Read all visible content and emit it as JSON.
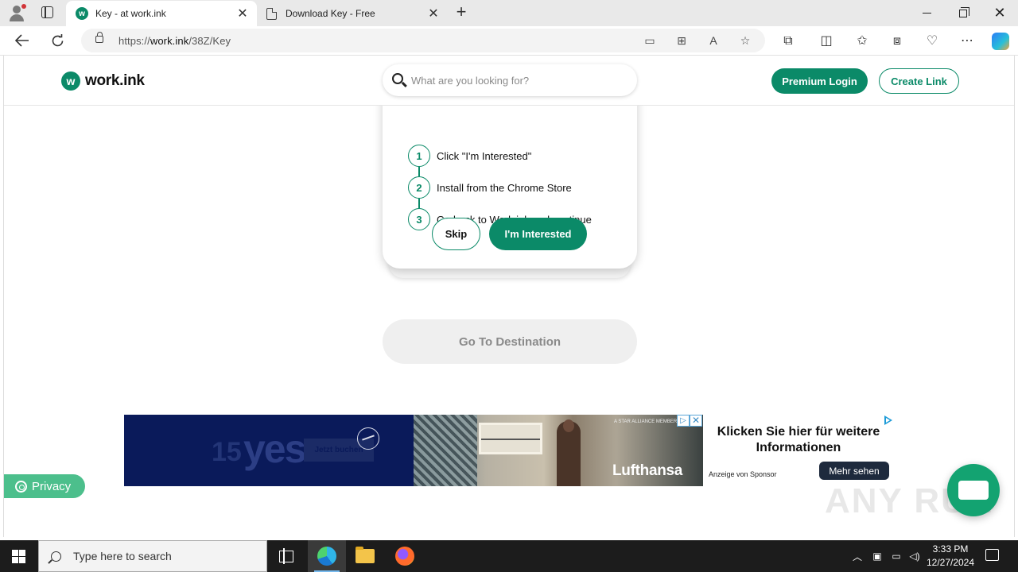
{
  "browser": {
    "tabs": [
      {
        "title": "Key - at work.ink",
        "favicon": "work-ink-icon",
        "active": true
      },
      {
        "title": "Download Key - Free",
        "favicon": "page-icon",
        "active": false
      }
    ],
    "tab_close": "✕",
    "new_tab": "+",
    "url_prefix": "https://",
    "url_host": "work.ink",
    "url_path": "/38Z/Key"
  },
  "site": {
    "logo_mark": "w",
    "logo_text": "work.ink",
    "search_placeholder": "What are you looking for?",
    "premium_login": "Premium Login",
    "create_link": "Create Link"
  },
  "modal": {
    "steps": [
      {
        "num": "1",
        "text": "Click \"I'm Interested\""
      },
      {
        "num": "2",
        "text": "Install from the Chrome Store"
      },
      {
        "num": "3",
        "text": "Go back to Work.ink and continue"
      }
    ],
    "skip": "Skip",
    "interested": "I'm Interested"
  },
  "destination_button": "Go To Destination",
  "ad": {
    "big_text": "yes",
    "cta_left": "Jetzt buchen",
    "brand": "Lufthansa",
    "alliance": "A STAR ALLIANCE MEMBER",
    "headline": "Klicken Sie hier für weitere Informationen",
    "sponsor": "Anzeige von Sponsor",
    "more": "Mehr sehen",
    "close": "✕",
    "adchoice": "▷"
  },
  "privacy_label": "Privacy",
  "watermark": "ANY RUN",
  "taskbar": {
    "search_placeholder": "Type here to search",
    "time": "3:33 PM",
    "date": "12/27/2024"
  },
  "colors": {
    "brand_green": "#0b8a68",
    "privacy_green": "#4cbf8c",
    "chat_green": "#13a371"
  }
}
